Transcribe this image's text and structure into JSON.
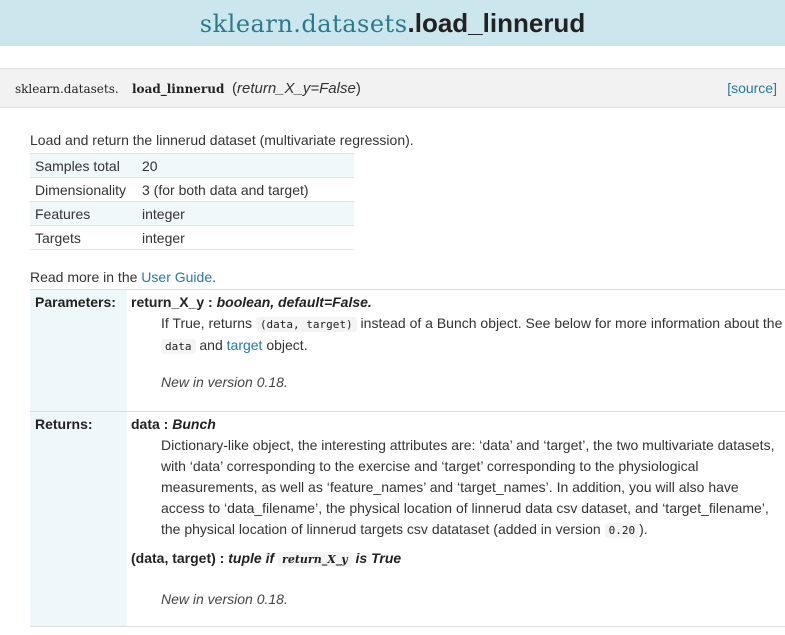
{
  "header": {
    "module": "sklearn.datasets",
    "function": ".load_linnerud"
  },
  "signature": {
    "module": "sklearn.datasets.",
    "name": "load_linnerud",
    "params_open": "(",
    "params": "return_X_y=False",
    "params_close": ")",
    "source_label": "[source]"
  },
  "summary": "Load and return the linnerud dataset (multivariate regression).",
  "table": [
    {
      "key": "Samples total",
      "value": "20"
    },
    {
      "key": "Dimensionality",
      "value": "3 (for both data and target)"
    },
    {
      "key": "Features",
      "value": "integer"
    },
    {
      "key": "Targets",
      "value": "integer"
    }
  ],
  "readmore": {
    "prefix": "Read more in the ",
    "link": "User Guide",
    "suffix": "."
  },
  "parameters": {
    "label": "Parameters:",
    "name": "return_X_y",
    "sep": " : ",
    "type": "boolean, default=False.",
    "desc_1": "If True, returns ",
    "code_1": "(data, target)",
    "desc_2": " instead of a Bunch object. See below for more information about the ",
    "code_2": "data",
    "desc_3": " and ",
    "link_target": "target",
    "desc_4": " object.",
    "version": "New in version 0.18."
  },
  "returns": {
    "label": "Returns:",
    "r1_name": "data",
    "r1_sep": " : ",
    "r1_type": "Bunch",
    "r1_desc_a": "Dictionary-like object, the interesting attributes are: ‘data’ and ‘target’, the two multivariate datasets, with ‘data’ corresponding to the exercise and ‘target’ corresponding to the physiological measurements, as well as ‘feature_names’ and ‘target_names’. In addition, you will also have access to ‘data_filename’, the physical location of linnerud data csv dataset, and ‘target_filename’, the physical location of linnerud targets csv datataset (added in version ",
    "r1_code": "0.20",
    "r1_desc_b": ").",
    "r2_name": "(data, target)",
    "r2_sep": " : ",
    "r2_type_a": "tuple if ",
    "r2_code": "return_X_y",
    "r2_type_b": " is True",
    "version": "New in version 0.18."
  }
}
